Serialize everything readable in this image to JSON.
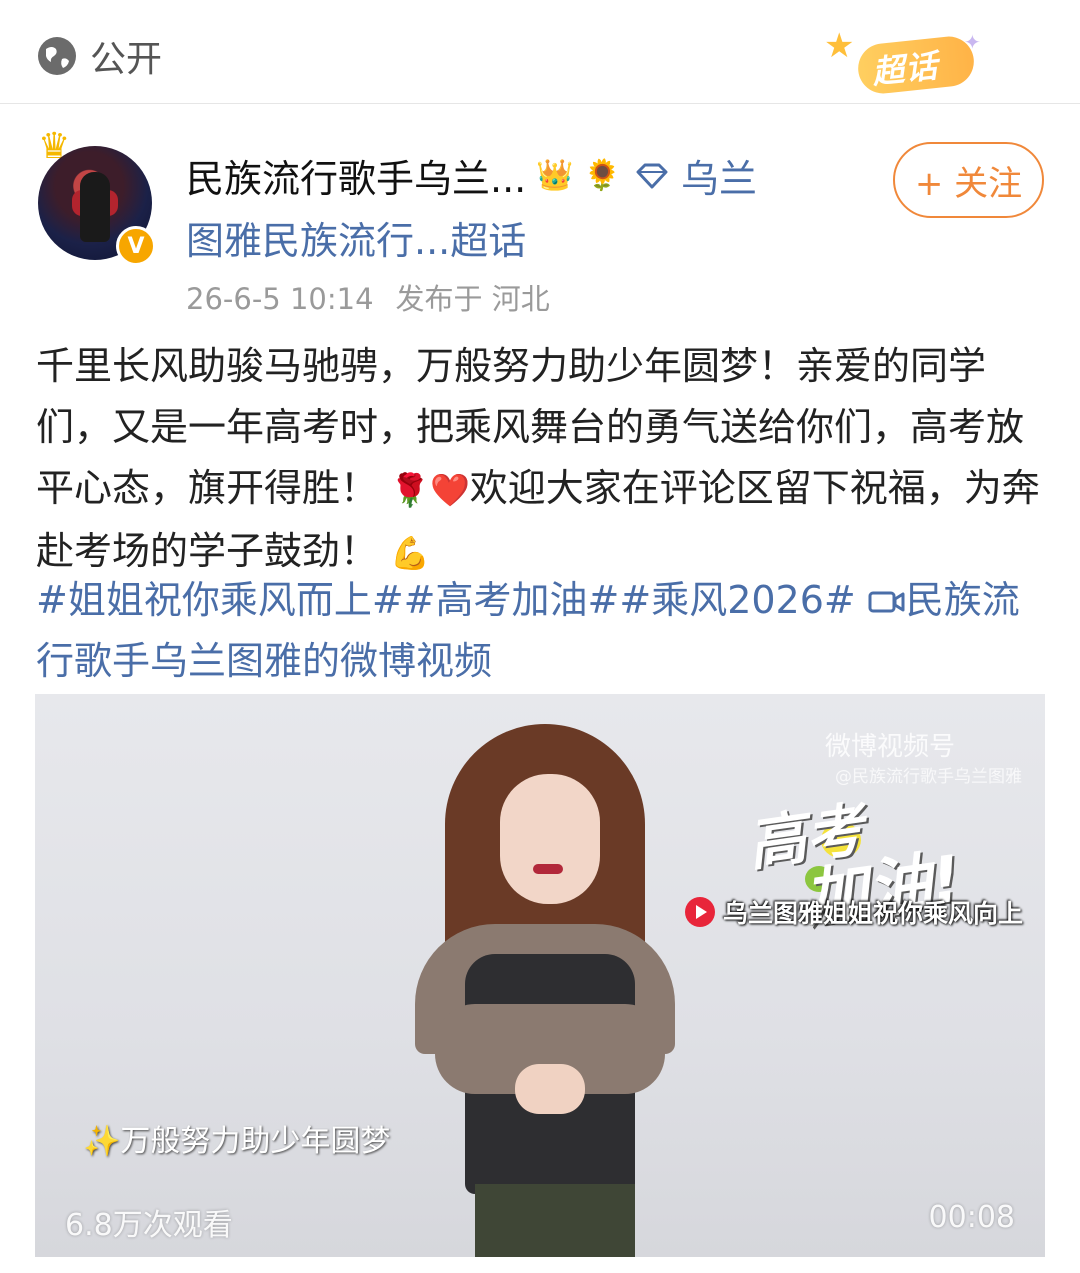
{
  "topbar": {
    "visibility_label": "公开",
    "supertopic_label": "超话"
  },
  "author": {
    "name": "民族流行歌手乌兰...",
    "verified_mark": "V",
    "badges": [
      "crown-icon",
      "sunflower-icon",
      "diamond-icon"
    ],
    "topic_line1": "乌兰",
    "topic_line2": "图雅民族流行...超话",
    "timestamp": "26-6-5 10:14",
    "location": "发布于 河北",
    "follow_label": "+ 关注"
  },
  "post": {
    "text_part1": "千里长风助骏马驰骋，万般努力助少年圆梦！亲爱的同学们，又是一年高考时，把乘风舞台的勇气送给你们，高考放平心态，旗开得胜！",
    "emoji1": "🌹❤️",
    "text_part2": "欢迎大家在评论区留下祝福，为奔赴考场的学子鼓劲！",
    "emoji2": "💪",
    "hashtags": "#姐姐祝你乘风而上##高考加油##乘风2026#",
    "video_link": "民族流行歌手乌兰图雅的微博视频"
  },
  "video": {
    "watermark": "微博视频号",
    "watermark_sub": "@民族流行歌手乌兰图雅",
    "overlay_line1": "高考",
    "overlay_line2": "加油!",
    "caption_tag": "乌兰图雅姐姐祝你乘风向上",
    "subtitle": "✨万般努力助少年圆梦",
    "views": "6.8万次观看",
    "duration": "00:08"
  },
  "colors": {
    "link_blue": "#4a6ea8",
    "follow_orange": "#f0883a",
    "supertopic_gold": "#ffb347"
  }
}
